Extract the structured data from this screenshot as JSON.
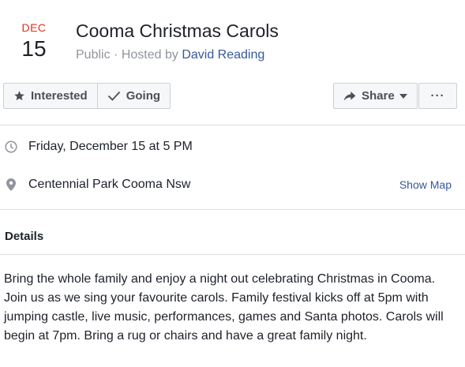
{
  "event": {
    "month": "DEC",
    "day": "15",
    "title": "Cooma Christmas Carols",
    "visibility": "Public",
    "hosted_by_prefix": "Hosted by",
    "host": "David Reading"
  },
  "actions": {
    "interested": "Interested",
    "going": "Going",
    "share": "Share",
    "more": "···"
  },
  "info": {
    "datetime": "Friday, December 15 at 5 PM",
    "location": "Centennial Park Cooma Nsw",
    "show_map": "Show Map"
  },
  "details": {
    "heading": "Details",
    "description": "Bring the whole family and enjoy a night out celebrating Christmas in Cooma. Join us as we sing your favourite carols. Family festival kicks off at 5pm with jumping castle, live music, performances, games and Santa photos. Carols will begin at 7pm. Bring a rug or chairs and have a great family night."
  },
  "icons": {
    "interested": "star-icon",
    "going": "check-icon",
    "share": "share-arrow-icon",
    "share_menu": "caret-down-icon",
    "time": "clock-icon",
    "location": "map-pin-icon"
  },
  "colors": {
    "month": "#e0301e",
    "link": "#365899",
    "muted": "#90949c",
    "text": "#1d2129"
  }
}
